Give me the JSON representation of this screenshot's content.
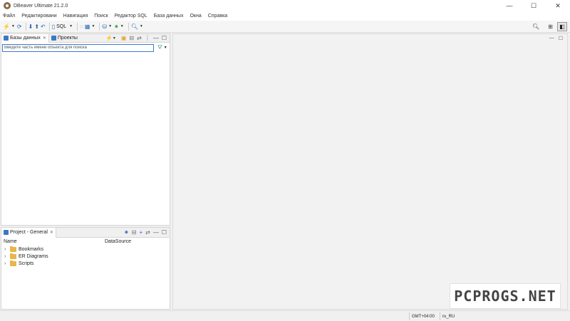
{
  "window": {
    "title": "DBeaver Ultimate 21.2.0",
    "controls": {
      "minimize": "—",
      "maximize": "☐",
      "close": "✕"
    }
  },
  "menu": [
    "Файл",
    "Редактировани",
    "Навигация",
    "Поиск",
    "Редактор SQL",
    "База данных",
    "Окна",
    "Справка"
  ],
  "toolbar": {
    "sql_label": "SQL",
    "icons": [
      "new-connection-icon",
      "connect-icon",
      "disconnect-icon",
      "commit-icon",
      "rollback-icon",
      "sql-editor-icon",
      "open-sql-icon",
      "data-icon",
      "transaction-icon",
      "search-icon",
      "global-search-icon",
      "perspective-icon"
    ]
  },
  "db_navigator": {
    "tabs": [
      {
        "label": "Базы данных",
        "close": "✕"
      },
      {
        "label": "Проекты"
      }
    ],
    "search": {
      "placeholder": "Введите часть имени объекта для поиска",
      "value": ""
    }
  },
  "project_panel": {
    "tab": {
      "label": "Project - General",
      "close": "✕"
    },
    "columns": [
      "Name",
      "DataSource"
    ],
    "items": [
      {
        "label": "Bookmarks"
      },
      {
        "label": "ER Diagrams"
      },
      {
        "label": "Scripts"
      }
    ]
  },
  "statusbar": {
    "timezone": "GMT+04:00",
    "locale": "ru_RU"
  },
  "watermark": "PCPROGS.NET",
  "colors": {
    "accent": "#3a7bd5",
    "folder": "#e8b64a"
  }
}
